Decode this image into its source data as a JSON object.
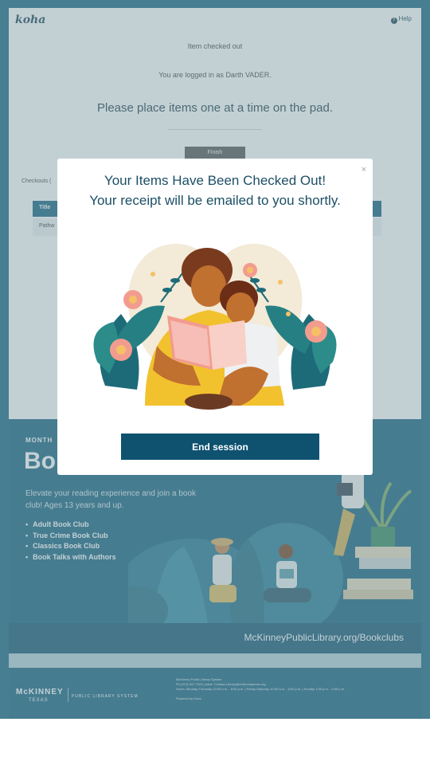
{
  "header": {
    "logo_text": "koha",
    "help_label": "Help"
  },
  "main": {
    "status_text": "Item checked out",
    "logged_in_text": "You are logged in as Darth VADER.",
    "instruction": "Please place items one at a time on the pad.",
    "finish_label": "Finish",
    "checkouts_label": "Checkouts (",
    "table_header_title": "Title",
    "table_row_title": "Pathw"
  },
  "banner": {
    "month_label": "MONTH",
    "title": "Bo",
    "description": "Elevate your reading experience and join a book club! Ages 13 years and up.",
    "clubs": [
      "Adult Book Club",
      "True Crime Book Club",
      "Classics Book Club",
      "Book Talks with Authors"
    ],
    "url": "McKinneyPublicLibrary.org/Bookclubs"
  },
  "footer": {
    "logo_text": "McKINNEY",
    "logo_sub": "TEXAS",
    "system_text": "PUBLIC LIBRARY SYSTEM",
    "info_line1": "McKinney Public Library System",
    "info_line2": "Ph (972) 547-7323 | Adult: Contact-Library@mckinneytexas.org",
    "info_line3": "Hours: Monday-Thursday 10:00 a.m. - 8:00 p.m. | Friday-Saturday 10:00 a.m. - 6:00 p.m. | Sunday 1:00 p.m. - 5:00 p.m.",
    "powered_by": "Powered by Koha"
  },
  "modal": {
    "close_glyph": "×",
    "title_line1": "Your Items Have Been Checked Out!",
    "title_line2": "Your receipt will be emailed to you shortly.",
    "end_session_label": "End session"
  },
  "colors": {
    "brand_teal": "#1e6684",
    "button_dark": "#0f5270",
    "heading": "#1c4f66"
  },
  "icons": {
    "help": "question-circle-icon",
    "close": "close-icon"
  }
}
